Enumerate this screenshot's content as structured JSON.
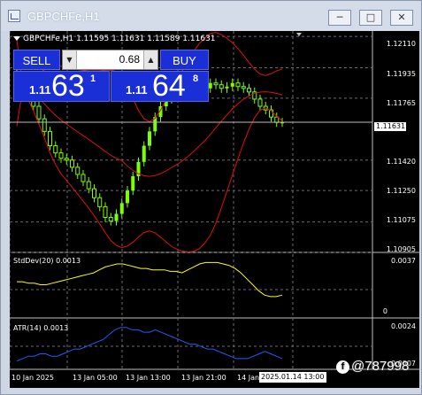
{
  "window": {
    "title": "GBPCHFe,H1",
    "minimize_icon": "minimize-icon",
    "maximize_icon": "maximize-icon",
    "close_icon": "close-icon"
  },
  "symbol_line": "GBPCHFe,H1  1.11595 1.11631 1.11589 1.11631",
  "trade": {
    "sell_label": "SELL",
    "buy_label": "BUY",
    "lot": "0.68",
    "sell_small": "1.11",
    "sell_big": "63",
    "sell_sup": "1",
    "buy_small": "1.11",
    "buy_big": "64",
    "buy_sup": "8"
  },
  "price_axis": [
    "1.12110",
    "1.11935",
    "1.11765",
    "1.11420",
    "1.11250",
    "1.11075",
    "1.10905"
  ],
  "current_price": "1.11631",
  "stddev": {
    "label": "StdDev(20) 0.0013",
    "top": "0.0037",
    "bottom": "0"
  },
  "atr": {
    "label": "ATR(14) 0.0013",
    "top": "0.0024",
    "bottom": "0.0007"
  },
  "time_axis": [
    "10 Jan 2025",
    "13 Jan 05:00",
    "13 Jan 13:00",
    "13 Jan 21:00",
    "14 Jan"
  ],
  "time_cursor": "2025.01.14 13:00",
  "watermark": "@787998",
  "colors": {
    "background": "#000000",
    "bull": "#7dff00",
    "bands": "#e01010",
    "stddev": "#ffff00",
    "atr": "#1e5cff",
    "panel": "#1b2fd6"
  },
  "chart_data": [
    {
      "type": "candlestick",
      "title": "GBPCHFe,H1",
      "ylim": [
        1.10905,
        1.1214
      ],
      "y_ticks": [
        1.1211,
        1.11935,
        1.11765,
        1.1142,
        1.1125,
        1.11075,
        1.10905
      ],
      "overlay": "Bollinger Bands",
      "close": [
        1.1185,
        1.1182,
        1.1178,
        1.1172,
        1.1165,
        1.1158,
        1.115,
        1.1146,
        1.1143,
        1.1142,
        1.1138,
        1.1134,
        1.113,
        1.1126,
        1.1121,
        1.1116,
        1.111,
        1.1108,
        1.1112,
        1.1118,
        1.1125,
        1.1133,
        1.1141,
        1.115,
        1.1158,
        1.1166,
        1.1172,
        1.1176,
        1.118,
        1.1178,
        1.118,
        1.1183,
        1.1185,
        1.1184,
        1.1182,
        1.1185,
        1.1184,
        1.1182,
        1.1183,
        1.1185,
        1.1183,
        1.1182,
        1.118,
        1.1176,
        1.1172,
        1.117,
        1.1166,
        1.1163,
        1.1163
      ]
    },
    {
      "type": "line",
      "name": "StdDev(20)",
      "ylim": [
        0,
        0.0037
      ],
      "values": [
        0.0022,
        0.0022,
        0.0021,
        0.0021,
        0.002,
        0.002,
        0.0021,
        0.0022,
        0.0023,
        0.0024,
        0.0025,
        0.0026,
        0.0027,
        0.0028,
        0.003,
        0.0032,
        0.0033,
        0.0034,
        0.0034,
        0.0033,
        0.0032,
        0.0031,
        0.0031,
        0.003,
        0.003,
        0.003,
        0.0029,
        0.0029,
        0.0028,
        0.003,
        0.0032,
        0.0034,
        0.0035,
        0.0035,
        0.0035,
        0.0034,
        0.0033,
        0.0031,
        0.0028,
        0.0024,
        0.002,
        0.0016,
        0.0013,
        0.0012,
        0.0012,
        0.0013
      ]
    },
    {
      "type": "line",
      "name": "ATR(14)",
      "ylim": [
        0.0007,
        0.0024
      ],
      "values": [
        0.0009,
        0.001,
        0.0011,
        0.0011,
        0.0012,
        0.0012,
        0.0011,
        0.0011,
        0.0012,
        0.0013,
        0.0014,
        0.0014,
        0.0015,
        0.0016,
        0.0017,
        0.0018,
        0.002,
        0.0022,
        0.0023,
        0.0023,
        0.0022,
        0.0022,
        0.0021,
        0.0021,
        0.0022,
        0.0021,
        0.002,
        0.0019,
        0.0018,
        0.0017,
        0.0016,
        0.0016,
        0.0015,
        0.0014,
        0.0014,
        0.0013,
        0.0012,
        0.0011,
        0.001,
        0.001,
        0.001,
        0.0011,
        0.0012,
        0.0013,
        0.0012,
        0.0011,
        0.001
      ]
    }
  ]
}
